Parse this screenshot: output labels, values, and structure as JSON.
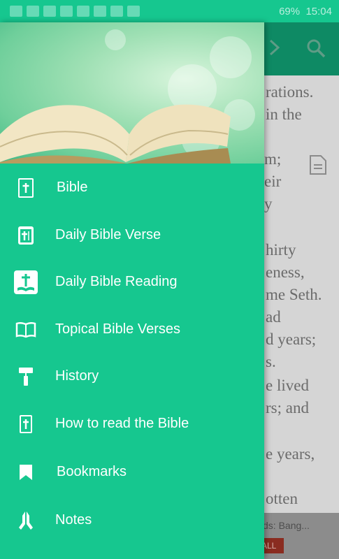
{
  "status_bar": {
    "time": "15:04",
    "battery": "69%"
  },
  "background": {
    "lines": [
      "rations.",
      "in the",
      "m;",
      "eir",
      "y",
      "hirty",
      "eness,",
      "me Seth.",
      "ad",
      "d years;",
      "s.",
      "e lived",
      "rs; and",
      "e years,",
      "otten"
    ],
    "ad_title": "ds: Bang...",
    "ad_badge": "ALL"
  },
  "drawer": {
    "menu": [
      {
        "label": "Bible",
        "icon": "bible-book-icon"
      },
      {
        "label": "Daily Bible Verse",
        "icon": "daily-verse-icon"
      },
      {
        "label": "Daily Bible Reading",
        "icon": "daily-reading-icon"
      },
      {
        "label": "Topical Bible Verses",
        "icon": "open-book-icon"
      },
      {
        "label": "History",
        "icon": "paint-roller-icon"
      },
      {
        "label": "How to read the Bible",
        "icon": "bible-small-icon"
      },
      {
        "label": "Bookmarks",
        "icon": "bookmark-icon"
      },
      {
        "label": "Notes",
        "icon": "praying-hands-icon"
      }
    ]
  }
}
